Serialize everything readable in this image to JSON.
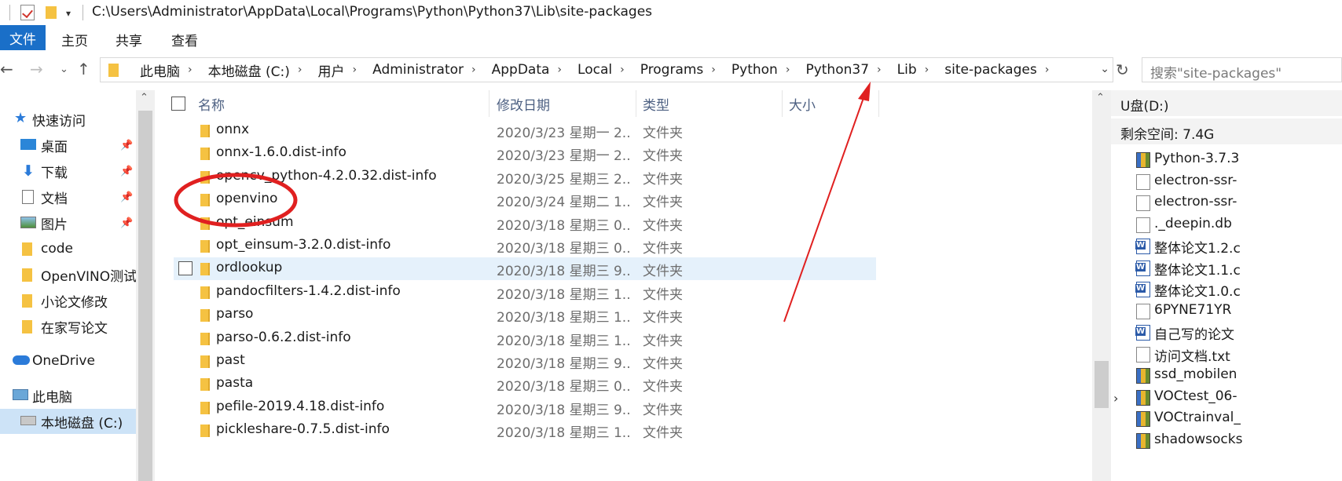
{
  "title_bar": {
    "path": "C:\\Users\\Administrator\\AppData\\Local\\Programs\\Python\\Python37\\Lib\\site-packages"
  },
  "ribbon": {
    "file": "文件",
    "home": "主页",
    "share": "共享",
    "view": "查看"
  },
  "address": {
    "crumbs": [
      "此电脑",
      "本地磁盘 (C:)",
      "用户",
      "Administrator",
      "AppData",
      "Local",
      "Programs",
      "Python",
      "Python37",
      "Lib",
      "site-packages"
    ]
  },
  "search": {
    "placeholder": "搜索\"site-packages\""
  },
  "nav": {
    "quick_access": "快速访问",
    "desktop": "桌面",
    "downloads": "下载",
    "documents": "文档",
    "pictures": "图片",
    "code": "code",
    "openvino_test": "OpenVINO测试",
    "small_paper": "小论文修改",
    "home_paper": "在家写论文",
    "onedrive": "OneDrive",
    "this_pc": "此电脑",
    "local_disk": "本地磁盘 (C:)"
  },
  "columns": {
    "name": "名称",
    "date": "修改日期",
    "type": "类型",
    "size": "大小"
  },
  "files": [
    {
      "name": "onnx",
      "date": "2020/3/23 星期一 2...",
      "type": "文件夹"
    },
    {
      "name": "onnx-1.6.0.dist-info",
      "date": "2020/3/23 星期一 2...",
      "type": "文件夹"
    },
    {
      "name": "opencv_python-4.2.0.32.dist-info",
      "date": "2020/3/25 星期三 2...",
      "type": "文件夹"
    },
    {
      "name": "openvino",
      "date": "2020/3/24 星期二 1...",
      "type": "文件夹"
    },
    {
      "name": "opt_einsum",
      "date": "2020/3/18 星期三 0...",
      "type": "文件夹"
    },
    {
      "name": "opt_einsum-3.2.0.dist-info",
      "date": "2020/3/18 星期三 0...",
      "type": "文件夹"
    },
    {
      "name": "ordlookup",
      "date": "2020/3/18 星期三 9...",
      "type": "文件夹"
    },
    {
      "name": "pandocfilters-1.4.2.dist-info",
      "date": "2020/3/18 星期三 1...",
      "type": "文件夹"
    },
    {
      "name": "parso",
      "date": "2020/3/18 星期三 1...",
      "type": "文件夹"
    },
    {
      "name": "parso-0.6.2.dist-info",
      "date": "2020/3/18 星期三 1...",
      "type": "文件夹"
    },
    {
      "name": "past",
      "date": "2020/3/18 星期三 9...",
      "type": "文件夹"
    },
    {
      "name": "pasta",
      "date": "2020/3/18 星期三 0...",
      "type": "文件夹"
    },
    {
      "name": "pefile-2019.4.18.dist-info",
      "date": "2020/3/18 星期三 9...",
      "type": "文件夹"
    },
    {
      "name": "pickleshare-0.7.5.dist-info",
      "date": "2020/3/18 星期三 1...",
      "type": "文件夹"
    }
  ],
  "right_pane": {
    "drive": "U盘(D:)",
    "free_space": "剩余空间: 7.4G",
    "items": [
      {
        "name": "Python-3.7.3",
        "icon": "zip-icon"
      },
      {
        "name": "electron-ssr-",
        "icon": "file-icon"
      },
      {
        "name": "electron-ssr-",
        "icon": "file-icon"
      },
      {
        "name": "._deepin.db",
        "icon": "db-file-icon"
      },
      {
        "name": "整体论文1.2.c",
        "icon": "word-icon"
      },
      {
        "name": "整体论文1.1.c",
        "icon": "word-icon"
      },
      {
        "name": "整体论文1.0.c",
        "icon": "word-icon"
      },
      {
        "name": "6PYNE71YR",
        "icon": "file-icon"
      },
      {
        "name": "自己写的论文",
        "icon": "word-icon"
      },
      {
        "name": "访问文档.txt",
        "icon": "text-file-icon"
      },
      {
        "name": "ssd_mobilen",
        "icon": "zip-icon"
      },
      {
        "name": "VOCtest_06-",
        "icon": "zip-icon"
      },
      {
        "name": "VOCtrainval_",
        "icon": "zip-icon"
      },
      {
        "name": "shadowsocks",
        "icon": "zip-icon"
      }
    ]
  },
  "colors": {
    "accent": "#1a6fc8",
    "selection": "#cde3f7",
    "hover": "#e5f1fb",
    "folder": "#f5c242",
    "annotation": "#e02020"
  }
}
